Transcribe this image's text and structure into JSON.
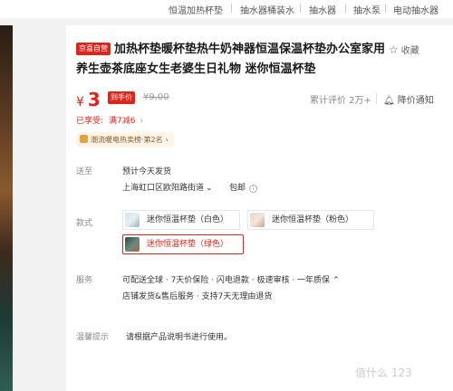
{
  "top_nav": [
    "恒温加热杯垫",
    "抽水器桶装水",
    "抽水器",
    "抽水泵",
    "电动抽水器"
  ],
  "badge": "京喜自营",
  "title": "加热杯垫暖杯垫热牛奶神器恒温保温杯垫办公室家用养生壶茶底座女生老婆生日礼物 迷你恒温杯垫",
  "favorite_label": "收藏",
  "price": {
    "currency": "¥",
    "value": "3",
    "tag": "到手价",
    "original": "¥9.00"
  },
  "reviews": "累计评价 2万+",
  "notify_label": "降价通知",
  "promo": {
    "label": "已享受:",
    "value": "满7减6"
  },
  "rank_badge": "潮流暖电热卖榜·第2名",
  "delivery": {
    "label": "送至",
    "eta": "预计今天发货",
    "address": "上海虹口区欧阳路街道",
    "shipping": "包邮"
  },
  "style": {
    "label": "款式",
    "options": [
      {
        "label": "迷你恒温杯垫（白色）",
        "selected": false
      },
      {
        "label": "迷你恒温杯垫（粉色）",
        "selected": false
      },
      {
        "label": "迷你恒温杯垫（绿色）",
        "selected": true
      }
    ]
  },
  "service": {
    "label": "服务",
    "line1": "可配送全球 · 7天价保险 · 闪电退款 · 极速审核 · 一年质保",
    "line2": "店铺发货&售后服务 · 支持7天无理由退货"
  },
  "tips": {
    "label": "温馨提示",
    "text": "请根据产品说明书进行使用。"
  },
  "watermark": "值什么 123",
  "colors": {
    "accent": "#e2231a"
  }
}
